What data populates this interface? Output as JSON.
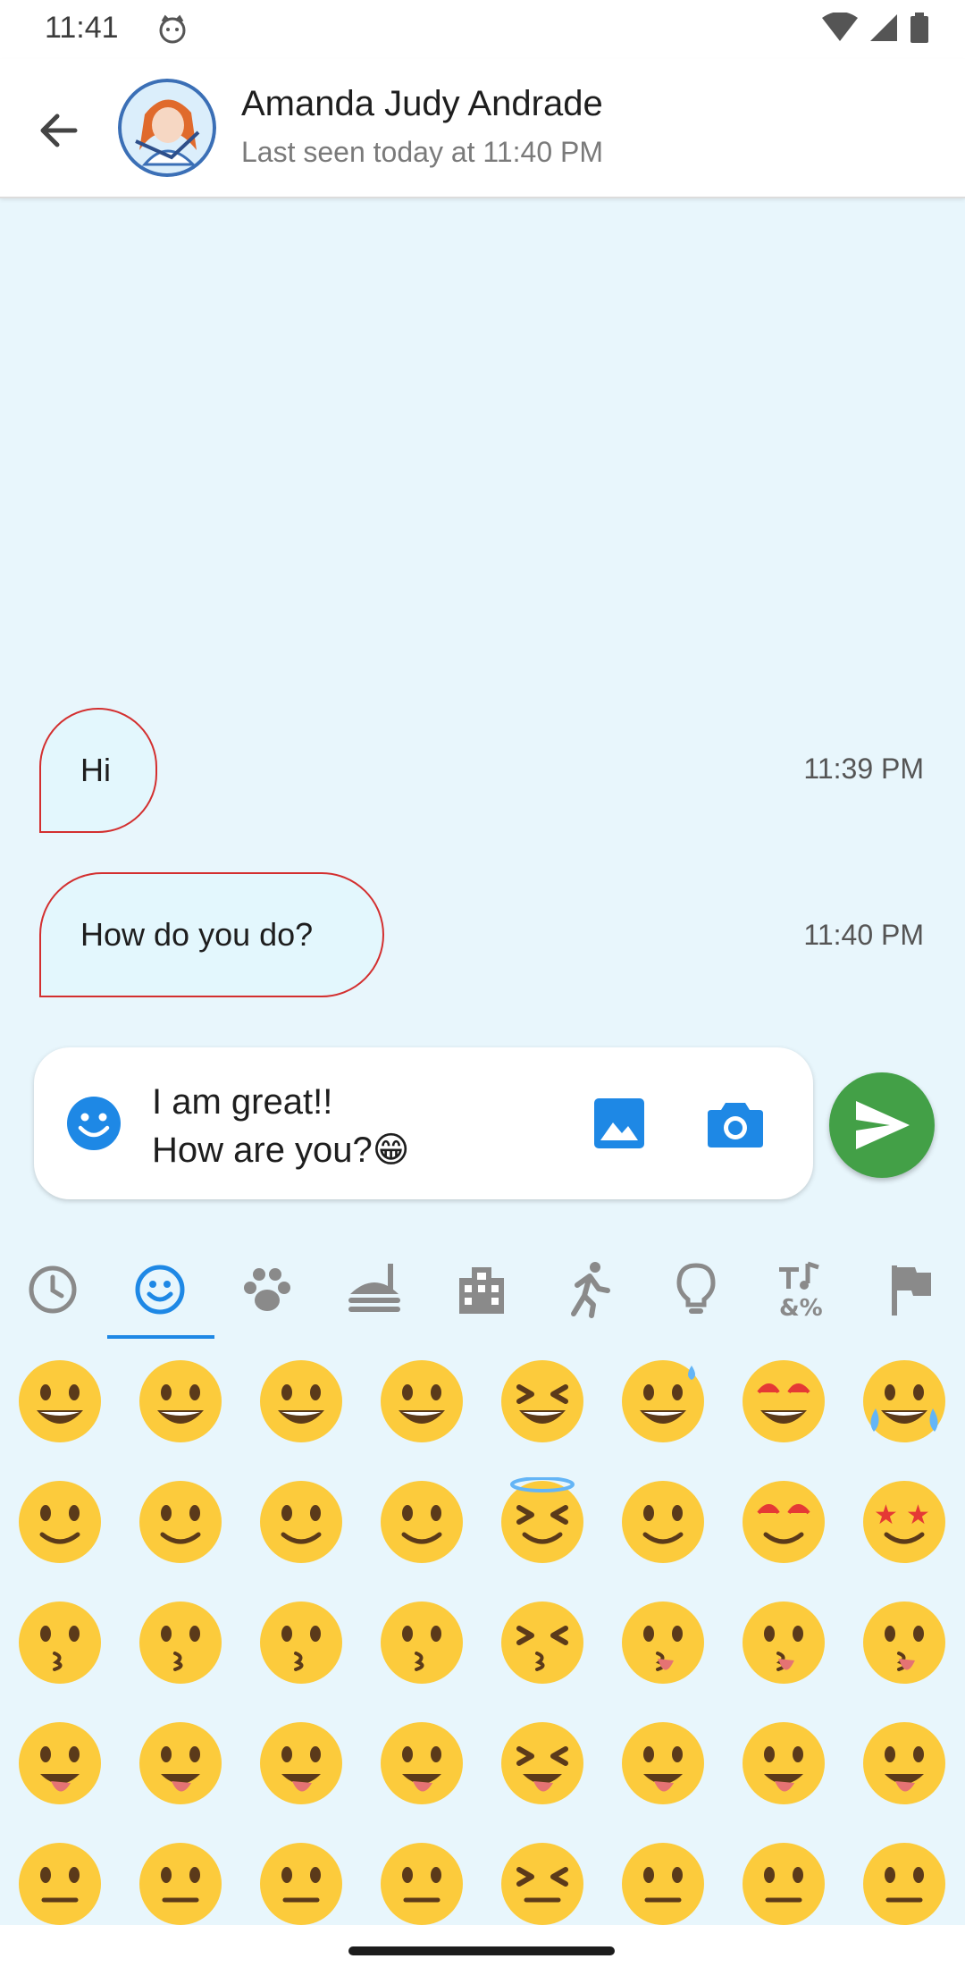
{
  "status_bar": {
    "time": "11:41"
  },
  "header": {
    "contact_name": "Amanda Judy Andrade",
    "last_seen": "Last seen today at 11:40 PM"
  },
  "messages": [
    {
      "text": "Hi",
      "time": "11:39 PM"
    },
    {
      "text": "How do you do?",
      "time": "11:40 PM"
    }
  ],
  "composer": {
    "text": "I am great!!\nHow are you?😁"
  },
  "emoji_tabs": [
    {
      "name": "recent-icon"
    },
    {
      "name": "smileys-icon",
      "selected": true
    },
    {
      "name": "animals-icon"
    },
    {
      "name": "food-icon"
    },
    {
      "name": "travel-places-icon"
    },
    {
      "name": "activities-icon"
    },
    {
      "name": "objects-icon"
    },
    {
      "name": "symbols-icon"
    },
    {
      "name": "flags-icon"
    }
  ],
  "emojis": [
    "😀",
    "😃",
    "😄",
    "😁",
    "😆",
    "😅",
    "🤣",
    "😂",
    "🙂",
    "🙃",
    "😉",
    "😊",
    "😇",
    "🥰",
    "😍",
    "🤩",
    "😘",
    "😗",
    "☺",
    "😚",
    "😙",
    "😋",
    "😛",
    "😜",
    "🤪",
    "😝",
    "🤑",
    "🤗",
    "🫣",
    "🤭",
    "🫢",
    "🫡",
    "🤫",
    "🫠",
    "🤔",
    "🤐",
    "🤨",
    "😐",
    "😕",
    "😑"
  ],
  "colors": {
    "accent": "#1e88e5",
    "send_button": "#43a047",
    "bubble_border": "#d32f2f",
    "chat_background": "#e8f6fc"
  }
}
